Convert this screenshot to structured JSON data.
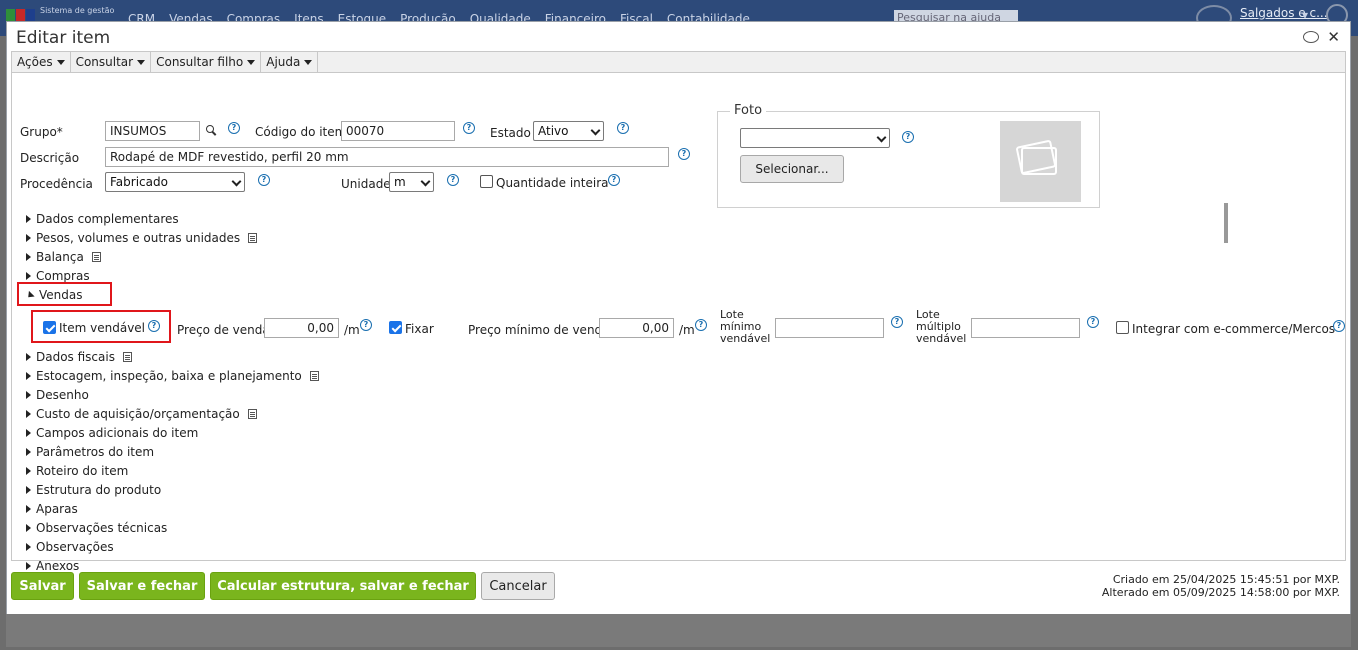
{
  "app": {
    "system_name": "Sistema de gestão",
    "menu": [
      "CRM",
      "Vendas",
      "Compras",
      "Itens",
      "Estoque",
      "Produção",
      "Qualidade",
      "Financeiro",
      "Fiscal",
      "Contabilidade"
    ],
    "search_placeholder": "Pesquisar na ajuda",
    "user": "Salgados e c..."
  },
  "dialog": {
    "title": "Editar item",
    "toolbar": [
      "Ações",
      "Consultar",
      "Consultar filho",
      "Ajuda"
    ]
  },
  "form": {
    "grupo_label": "Grupo*",
    "grupo_value": "INSUMOS",
    "codigo_label": "Código do item",
    "codigo_value": "00070",
    "estado_label": "Estado",
    "estado_value": "Ativo",
    "descricao_label": "Descrição",
    "descricao_value": "Rodapé de MDF revestido, perfil 20 mm",
    "procedencia_label": "Procedência",
    "procedencia_value": "Fabricado",
    "unidade_label": "Unidade",
    "unidade_value": "m",
    "qtd_inteira_label": "Quantidade inteira"
  },
  "foto": {
    "legend": "Foto",
    "select_value": "",
    "button": "Selecionar..."
  },
  "sections_top": [
    "Dados complementares",
    "Pesos, volumes e outras unidades",
    "Balança",
    "Compras"
  ],
  "vendas": {
    "title": "Vendas",
    "item_vendavel": "Item vendável",
    "preco_venda_label": "Preço de venda",
    "preco_venda_value": "0,00",
    "per_unit": "/m",
    "fixar": "Fixar",
    "preco_min_label": "Preço mínimo de venda",
    "preco_min_value": "0,00",
    "lote_min_label": [
      "Lote",
      "mínimo",
      "vendável"
    ],
    "lote_mult_label": [
      "Lote",
      "múltiplo",
      "vendável"
    ],
    "integrar": "Integrar com e-commerce/Mercos"
  },
  "sections_bottom": [
    "Dados fiscais",
    "Estocagem, inspeção, baixa e planejamento",
    "Desenho",
    "Custo de aquisição/orçamentação",
    "Campos adicionais do item",
    "Parâmetros do item",
    "Roteiro do item",
    "Estrutura do produto",
    "Aparas",
    "Observações técnicas",
    "Observações",
    "Anexos"
  ],
  "footer": {
    "salvar": "Salvar",
    "salvar_fechar": "Salvar e fechar",
    "calcular": "Calcular estrutura, salvar e fechar",
    "cancelar": "Cancelar",
    "criado": "Criado em 25/04/2025 15:45:51 por MXP.",
    "alterado": "Alterado em 05/09/2025 14:58:00 por MXP."
  }
}
